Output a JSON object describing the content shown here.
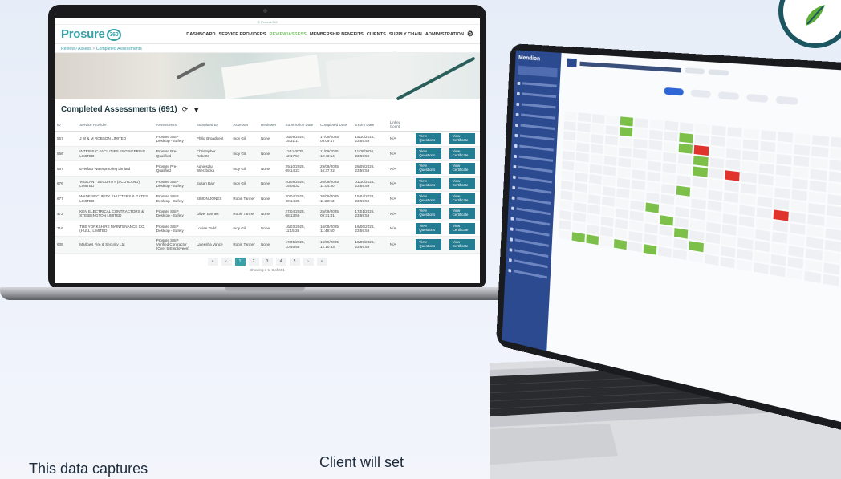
{
  "left_app": {
    "address_bar": "⓪ Procure360",
    "brand": "Prosure",
    "brand_mark": "360",
    "nav": [
      {
        "label": "DASHBOARD"
      },
      {
        "label": "SERVICE PROVIDERS"
      },
      {
        "label": "REVIEW/ASSESS"
      },
      {
        "label": "MEMBERSHIP BENEFITS"
      },
      {
        "label": "CLIENTS"
      },
      {
        "label": "SUPPLY CHAIN"
      },
      {
        "label": "ADMINISTRATION"
      }
    ],
    "breadcrumb": {
      "root": "Review / Assess",
      "sep": ">",
      "current": "Completed Assessments"
    },
    "title": "Completed Assessments (691)",
    "columns": [
      "ID",
      "Service Provider",
      "Assessment",
      "Submitted By",
      "Assessor",
      "Reviewer",
      "Submission Date",
      "Completed Date",
      "Expiry Date",
      "Linked Count",
      "",
      ""
    ],
    "rows": [
      [
        "567",
        "J W & M ROBSON LIMITED",
        "Prosure SSIP Desktop - Safety",
        "Philip Broadbent",
        "Indy Gill",
        "None",
        "16/09/2025, 15:31:17",
        "17/09/2025, 09:09:17",
        "15/10/2025, 23:59:59",
        "N/A",
        "View Questions",
        "View Certificate"
      ],
      [
        "566",
        "INTRINSIC FACILITIES ENGINEERING LIMITED",
        "Prosure Pre-Qualified",
        "Christopher Roberts",
        "Indy Gill",
        "None",
        "11/11/2025, 12:17:57",
        "11/09/2025, 12:43:14",
        "11/09/2026, 23:59:59",
        "N/A",
        "View Questions",
        "View Certificate"
      ],
      [
        "567",
        "Everfast Waterproofing Limited",
        "Prosure Pre-Qualified",
        "Agnieszka Wierzbicka",
        "Indy Gill",
        "None",
        "29/10/2025, 09:14:23",
        "29/09/2025, 16:37:22",
        "29/09/2026, 23:59:59",
        "N/A",
        "View Questions",
        "View Certificate"
      ],
      [
        "676",
        "VIGILANT SECURITY (SCOTLAND) LIMITED",
        "Prosure SSIP Desktop - Safety",
        "Susan Barr",
        "Indy Gill",
        "None",
        "20/09/2025, 15:05:32",
        "20/09/2025, 11:04:30",
        "01/10/2026, 23:59:59",
        "N/A",
        "View Questions",
        "View Certificate"
      ],
      [
        "677",
        "WADE SECURITY SHUTTERS & GATES LIMITED",
        "Prosure SSIP Desktop - Safety",
        "SIMON JONES",
        "Robin Tanner",
        "None",
        "20/04/2025, 09:14:35",
        "20/09/2025, 11:20:53",
        "15/04/2026, 23:59:59",
        "N/A",
        "View Questions",
        "View Certificate"
      ],
      [
        "472",
        "KEN ELECTRICAL CONTRACTORS & STEBBINGTON LIMITED",
        "Prosure SSIP Desktop - Safety",
        "Oliver Barnes",
        "Robin Tanner",
        "None",
        "27/04/2025, 08:13:59",
        "25/09/2025, 09:31:01",
        "17/01/2026, 23:59:59",
        "N/A",
        "View Questions",
        "View Certificate"
      ],
      [
        "716",
        "THE YORKSHIRE MAINTENANCE CO. (HULL) LIMITED",
        "Prosure SSIP Desktop - Safety",
        "Louise Todd",
        "Indy Gill",
        "None",
        "16/03/2025, 11:15:38",
        "16/09/2025, 11:49:50",
        "16/06/2026, 23:59:59",
        "N/A",
        "View Questions",
        "View Certificate"
      ],
      [
        "635",
        "Marlows Fire & Security Ltd",
        "Prosure SSIP Verified Contractor (Over 5 Employees)",
        "Lateesha Vance",
        "Robin Tanner",
        "None",
        "17/05/2025, 10:46:58",
        "16/09/2025, 12:10:53",
        "16/09/2026, 23:59:59",
        "N/A",
        "View Questions",
        "View Certificate"
      ]
    ],
    "pager": [
      "«",
      "‹",
      "1",
      "2",
      "3",
      "4",
      "5",
      "›",
      "»"
    ],
    "showing": "Showing 1 to 8 of 691"
  },
  "right_app": {
    "brand": "Mendion"
  },
  "bottom_copy": {
    "left": "This data captures",
    "right": "Client will set"
  },
  "colors": {
    "brand_teal": "#3aa0a8",
    "button_blue": "#247c93",
    "sidebar_blue": "#2b4a8f",
    "status_green": "#7cc04a",
    "status_red": "#e0332b",
    "nav_active": "#7bc06a"
  }
}
